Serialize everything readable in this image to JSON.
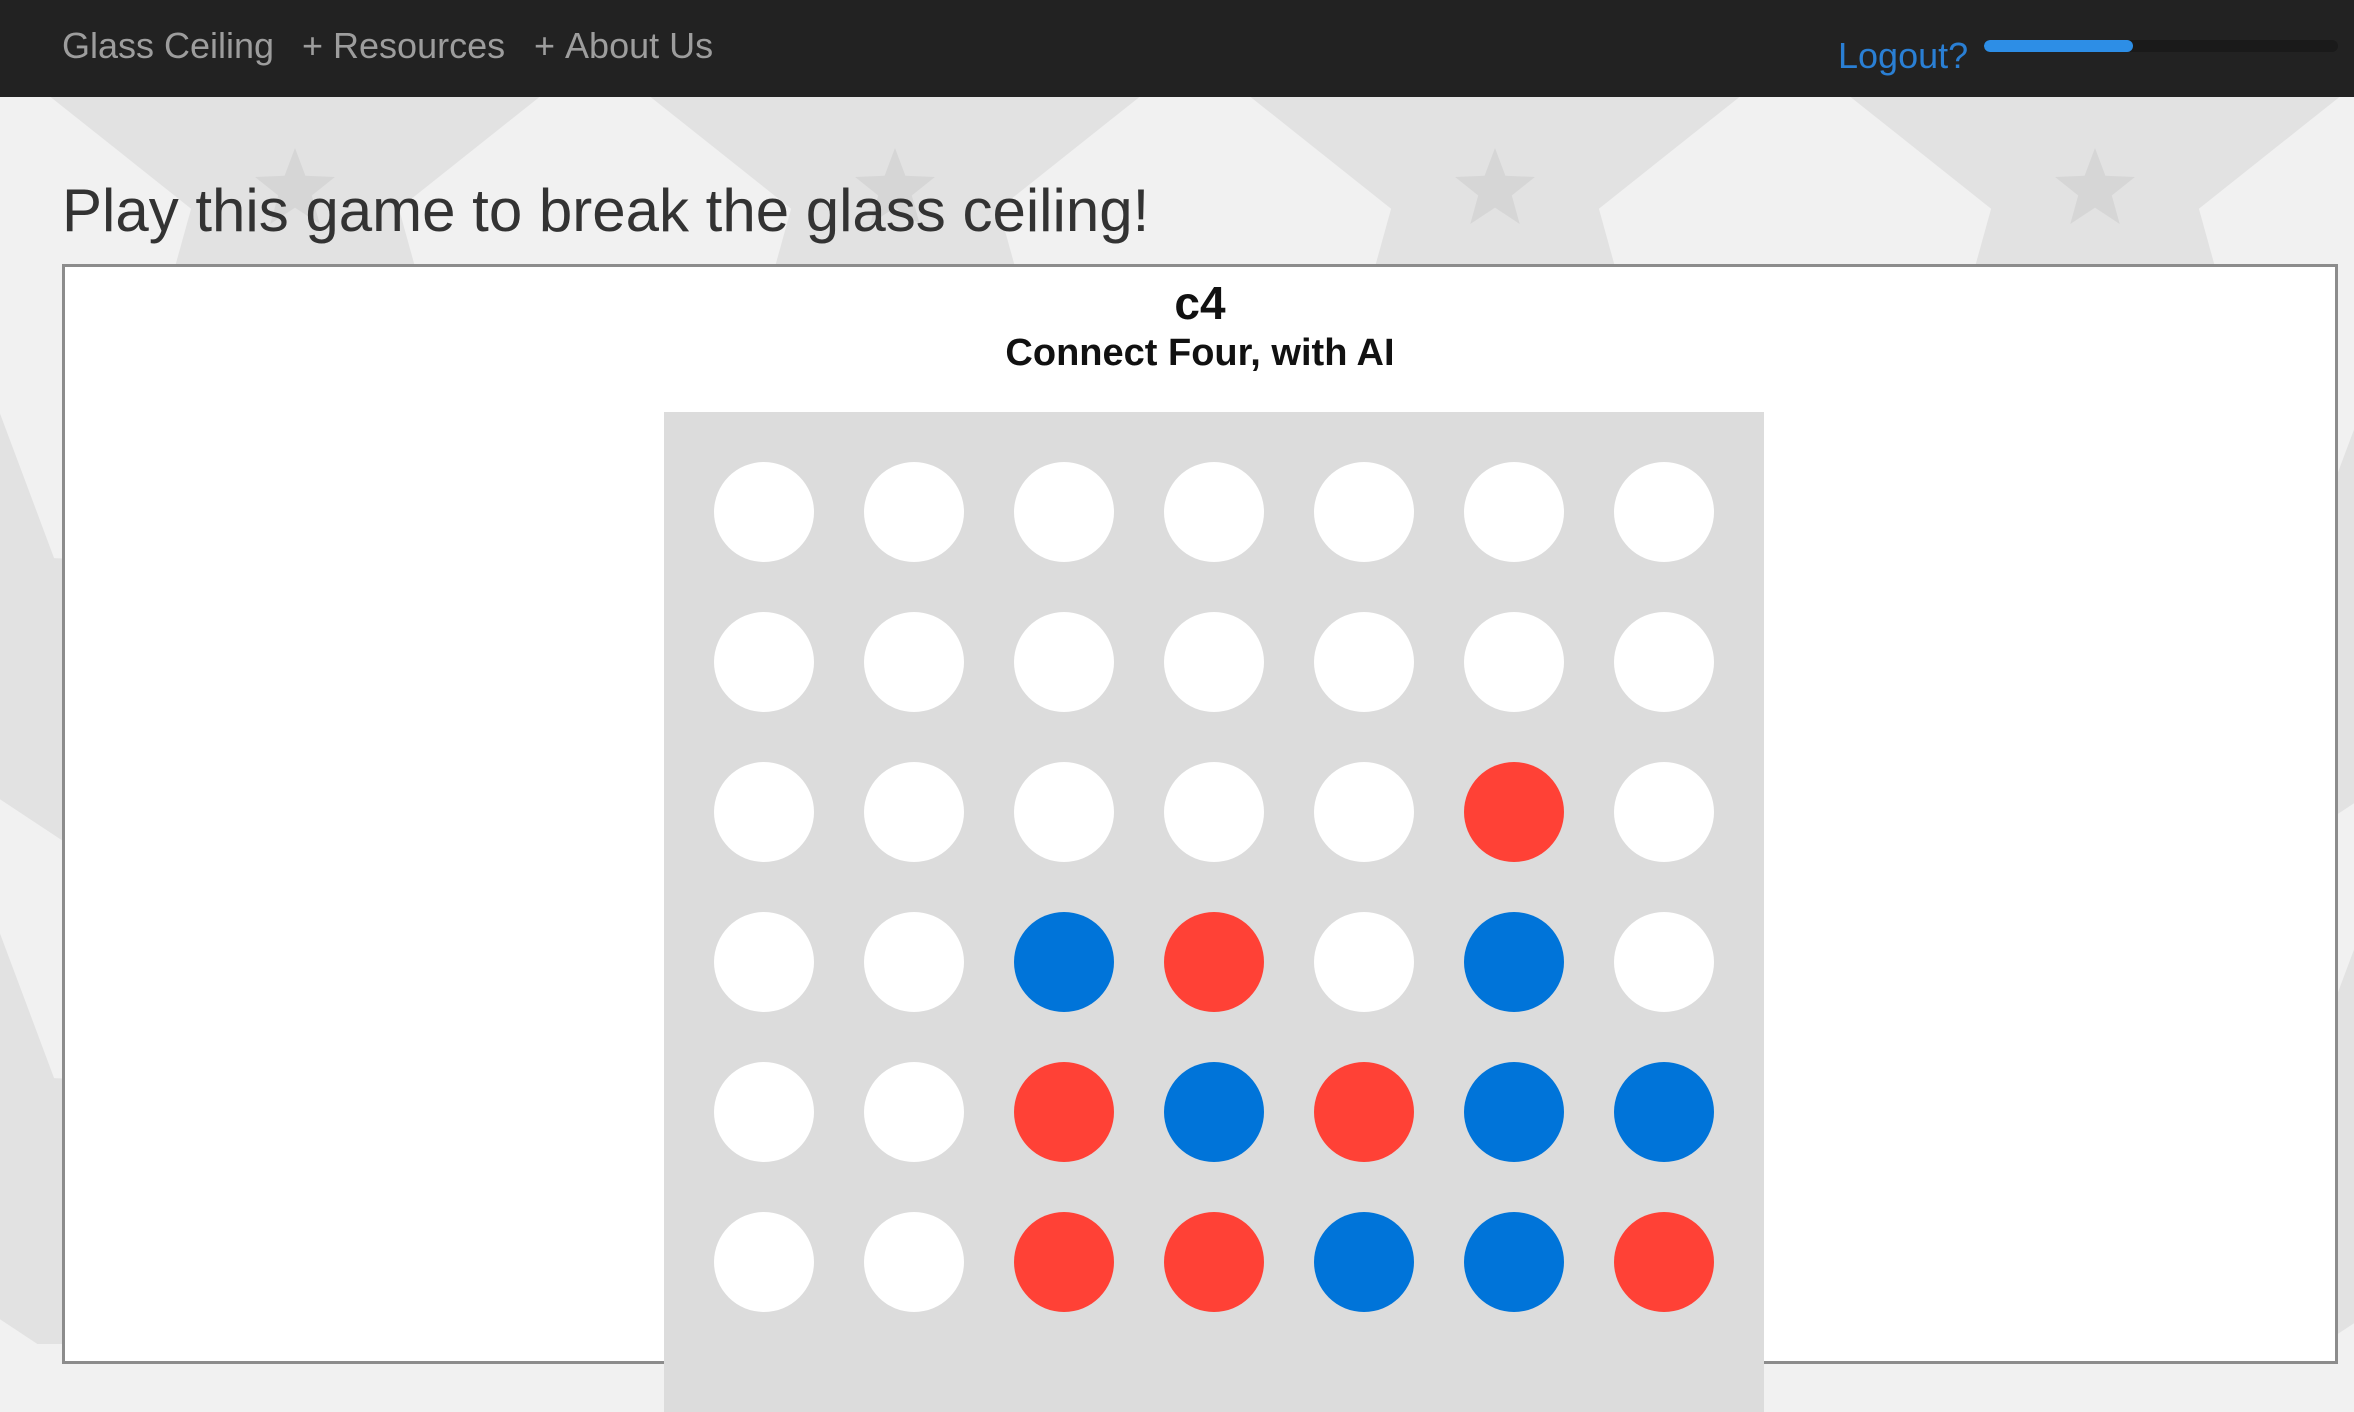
{
  "navbar": {
    "brand": "Glass Ceiling",
    "items": [
      {
        "plus": "+",
        "label": "Resources"
      },
      {
        "plus": "+",
        "label": "About Us"
      }
    ],
    "logout_label": "Logout?",
    "progress_fraction": 0.42
  },
  "page": {
    "heading": "Play this game to break the glass ceiling!"
  },
  "game": {
    "title": "c4",
    "subtitle": "Connect Four, with AI",
    "board_rows": [
      [
        "empty",
        "empty",
        "empty",
        "empty",
        "empty",
        "empty",
        "empty"
      ],
      [
        "empty",
        "empty",
        "empty",
        "empty",
        "empty",
        "empty",
        "empty"
      ],
      [
        "empty",
        "empty",
        "empty",
        "empty",
        "empty",
        "red",
        "empty"
      ],
      [
        "empty",
        "empty",
        "blue",
        "red",
        "empty",
        "blue",
        "empty"
      ],
      [
        "empty",
        "empty",
        "red",
        "blue",
        "red",
        "blue",
        "blue"
      ],
      [
        "empty",
        "empty",
        "red",
        "red",
        "blue",
        "blue",
        "red"
      ]
    ]
  },
  "colors": {
    "navbar_bg": "#222222",
    "nav_text": "#9d9d9d",
    "logout": "#2a7fd4",
    "progress": "#2d8ee6",
    "board_bg": "#dcdcdc",
    "empty": "#ffffff",
    "red": "#ff4136",
    "blue": "#0074d9",
    "background": "#f1f1f1",
    "star": "#e2e2e2"
  }
}
